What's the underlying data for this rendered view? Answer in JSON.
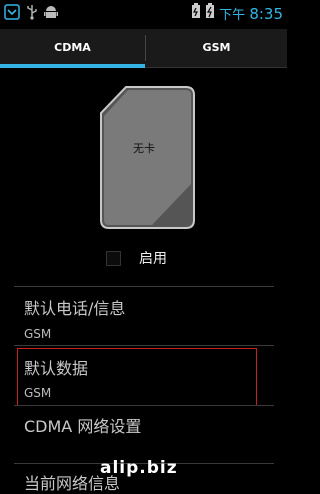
{
  "status_bar": {
    "icons_left": [
      "notification-icon",
      "usb-icon",
      "android-debug-icon"
    ],
    "icons_right": [
      "battery-icon",
      "battery-charging-icon"
    ],
    "time_prefix": "下午",
    "time": "8:35"
  },
  "tabs": [
    {
      "label": "CDMA",
      "selected": true
    },
    {
      "label": "GSM",
      "selected": false
    }
  ],
  "sim_card": {
    "label": "无卡"
  },
  "enable": {
    "label": "启用",
    "checked": false
  },
  "settings": [
    {
      "title": "默认电话/信息",
      "value": "GSM"
    },
    {
      "title": "默认数据",
      "value": "GSM"
    },
    {
      "title": "CDMA 网络设置"
    },
    {
      "title": "当前网络信息"
    }
  ],
  "watermark": "alip.biz",
  "colors": {
    "accent": "#33b5e5",
    "highlight_border": "#c8201d",
    "background": "#000000"
  }
}
